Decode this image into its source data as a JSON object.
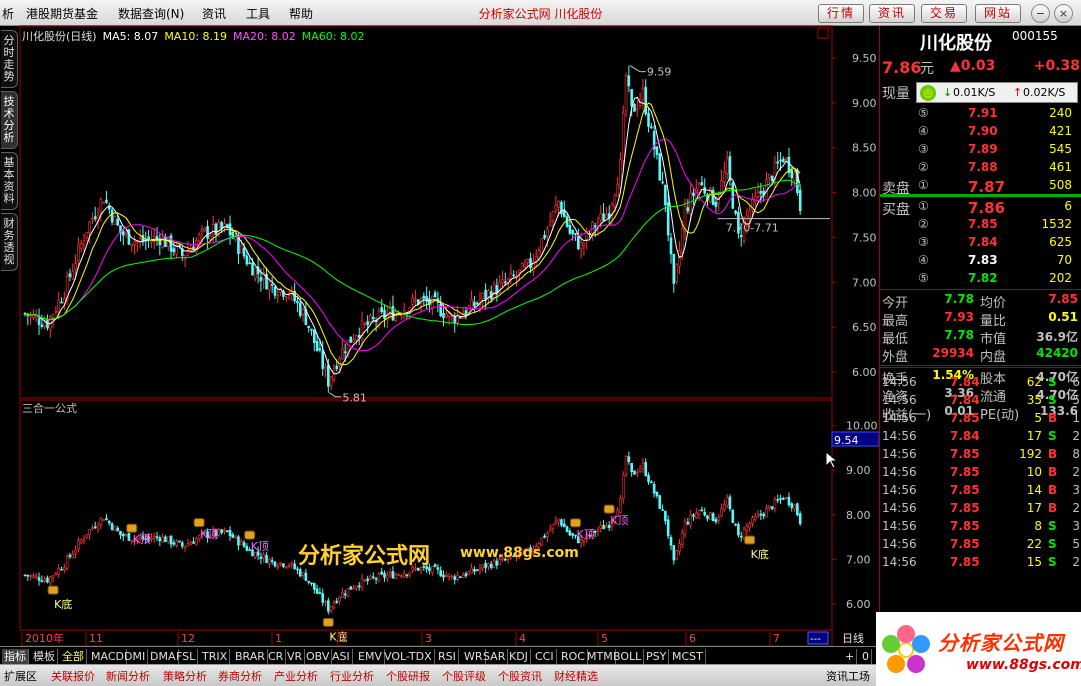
{
  "menubar": {
    "items": [
      "析",
      "港股期货基金",
      "数据查询(N)",
      "资讯",
      "工具",
      "帮助"
    ],
    "title": "分析家公式网  川化股份",
    "buttons": [
      "行情",
      "资讯",
      "交易",
      "网站"
    ]
  },
  "sidetabs": [
    "分时走势",
    "技术分析",
    "基本资料",
    "财务透视"
  ],
  "main_chart": {
    "legend": {
      "name": "川化股份(日线)",
      "ma5": "MA5: 8.07",
      "ma10": "MA10: 8.19",
      "ma20": "MA20: 8.02",
      "ma60": "MA60: 8.02"
    },
    "high_label": "9.59",
    "low_label": "5.81",
    "range_label": "7.70-7.71",
    "y_ticks": [
      "9.50",
      "9.00",
      "8.50",
      "8.00",
      "7.50",
      "7.00",
      "6.50",
      "6.00"
    ]
  },
  "sub_chart": {
    "title": "三合一公式",
    "current_value": "9.54",
    "y_ticks": [
      "10.00",
      "9.00",
      "8.00",
      "7.00",
      "6.00"
    ],
    "markers": [
      {
        "label": "K底",
        "type": "bottom"
      },
      {
        "label": "K顶",
        "type": "top"
      },
      {
        "label": "K顶",
        "type": "top"
      },
      {
        "label": "K顶",
        "type": "top"
      },
      {
        "label": "K底",
        "type": "bottom"
      },
      {
        "label": "K顶",
        "type": "top"
      },
      {
        "label": "K顶",
        "type": "top"
      },
      {
        "label": "K底",
        "type": "bottom"
      }
    ]
  },
  "x_axis": {
    "labels": [
      "2010年",
      "11",
      "12",
      "1",
      "2",
      "3",
      "4",
      "5",
      "6",
      "7"
    ],
    "period": "日线",
    "control": "---"
  },
  "indicator_tabs": [
    "指标",
    "模板",
    "全部",
    "MACD",
    "DMI",
    "DMA",
    "FSL",
    "TRIX",
    "BRAR",
    "CR",
    "VR",
    "OBV",
    "ASI",
    "EMV",
    "VOL-TDX",
    "RSI",
    "WR",
    "SAR",
    "KDJ",
    "CCI",
    "ROC",
    "MTM",
    "BOLL",
    "PSY",
    "MCST"
  ],
  "tab_controls": [
    "+",
    "0"
  ],
  "status_tabs": [
    "扩展区",
    "关联报价",
    "新闻分析",
    "策略分析",
    "券商分析",
    "产业分析",
    "行业分析",
    "个股研报",
    "个股评级",
    "个股资讯",
    "财经精选",
    "资讯工场"
  ],
  "quote": {
    "name": "川化股份",
    "code": "000155",
    "price": "7.86",
    "price_unit": "元",
    "change": "▲0.03",
    "change_pct": "+0.38",
    "current_volume_label": "现量",
    "popup": {
      "down": "0.01K/S",
      "up": "0.02K/S"
    },
    "sell_label": "卖盘",
    "buy_label": "买盘",
    "asks": [
      {
        "level": "⑤",
        "price": "7.91",
        "vol": "240"
      },
      {
        "level": "④",
        "price": "7.90",
        "vol": "421"
      },
      {
        "level": "③",
        "price": "7.89",
        "vol": "545"
      },
      {
        "level": "②",
        "price": "7.88",
        "vol": "461"
      },
      {
        "level": "①",
        "price": "7.87",
        "vol": "508"
      }
    ],
    "bids": [
      {
        "level": "①",
        "price": "7.86",
        "vol": "6"
      },
      {
        "level": "②",
        "price": "7.85",
        "vol": "1532"
      },
      {
        "level": "③",
        "price": "7.84",
        "vol": "625"
      },
      {
        "level": "④",
        "price": "7.83",
        "vol": "70"
      },
      {
        "level": "⑤",
        "price": "7.82",
        "vol": "202"
      }
    ],
    "stats": [
      {
        "l1": "今开",
        "v1": "7.78",
        "l2": "均价",
        "v2": "7.85"
      },
      {
        "l1": "最高",
        "v1": "7.93",
        "l2": "量比",
        "v2": "0.51"
      },
      {
        "l1": "最低",
        "v1": "7.78",
        "l2": "市值",
        "v2": "36.9亿"
      },
      {
        "l1": "外盘",
        "v1": "29934",
        "l2": "内盘",
        "v2": "42420"
      },
      {
        "l1": "换手",
        "v1": "1.54%",
        "l2": "股本",
        "v2": "4.70亿"
      },
      {
        "l1": "净资",
        "v1": "3.36",
        "l2": "流通",
        "v2": "4.70亿"
      },
      {
        "l1": "收益(一)",
        "v1": "0.01",
        "l2": "PE(动)",
        "v2": "133.6"
      }
    ],
    "trades": [
      {
        "time": "14:56",
        "price": "7.84",
        "vol": "62",
        "side": "S",
        "n": "6"
      },
      {
        "time": "14:56",
        "price": "7.84",
        "vol": "35",
        "side": "S",
        "n": "5"
      },
      {
        "time": "14:56",
        "price": "7.85",
        "vol": "5",
        "side": "B",
        "n": "1"
      },
      {
        "time": "14:56",
        "price": "7.84",
        "vol": "17",
        "side": "S",
        "n": "2"
      },
      {
        "time": "14:56",
        "price": "7.85",
        "vol": "192",
        "side": "B",
        "n": "8"
      },
      {
        "time": "14:56",
        "price": "7.85",
        "vol": "10",
        "side": "B",
        "n": "2"
      },
      {
        "time": "14:56",
        "price": "7.85",
        "vol": "14",
        "side": "B",
        "n": "3"
      },
      {
        "time": "14:56",
        "price": "7.85",
        "vol": "17",
        "side": "B",
        "n": "2"
      },
      {
        "time": "14:56",
        "price": "7.85",
        "vol": "8",
        "side": "S",
        "n": "3"
      },
      {
        "time": "14:56",
        "price": "7.85",
        "vol": "22",
        "side": "S",
        "n": "5"
      },
      {
        "time": "14:56",
        "price": "7.85",
        "vol": "15",
        "side": "S",
        "n": "2"
      }
    ]
  },
  "watermark": {
    "text": "分析家公式网",
    "url": "www.88gs.com"
  },
  "logo": {
    "text": "分析家公式网",
    "url": "www.88gs.com"
  },
  "colors": {
    "up": "#ff3232",
    "down": "#54fcfc",
    "ma5": "#ffffff",
    "ma10": "#ffff00",
    "ma20": "#ff00ff",
    "ma60": "#00ff00",
    "axis": "#a00000"
  }
}
